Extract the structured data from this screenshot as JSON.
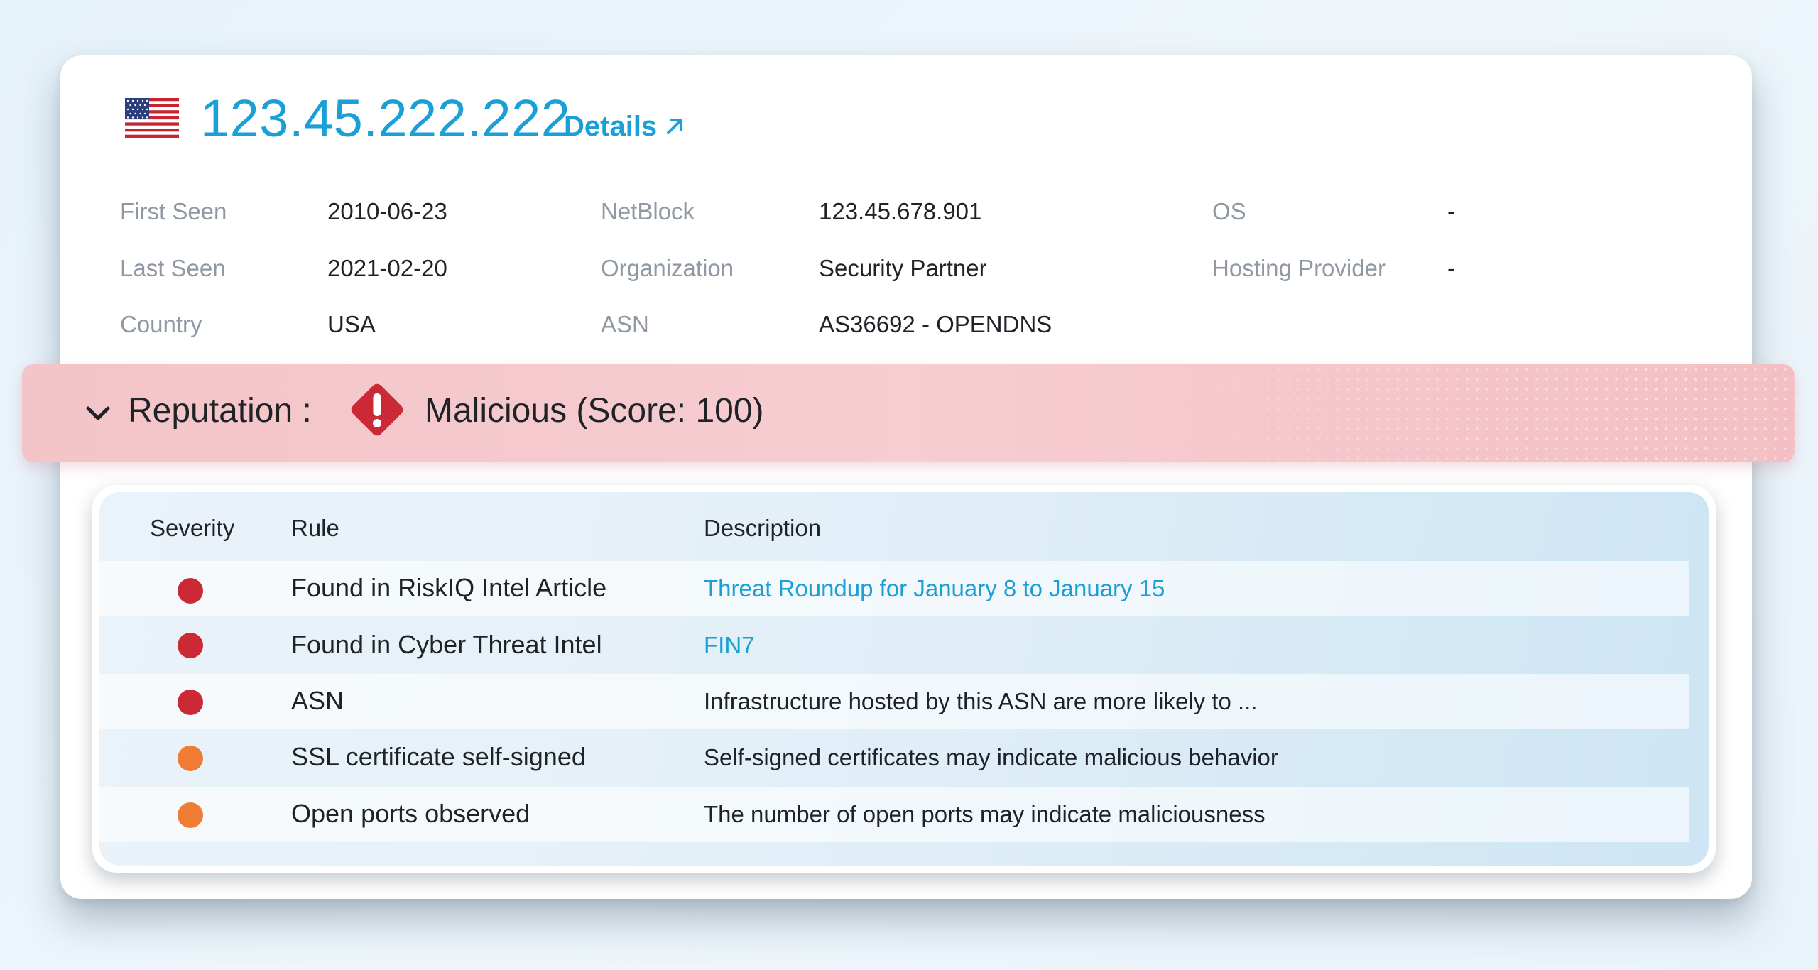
{
  "header": {
    "flag_icon": "us-flag-icon",
    "ip": "123.45.222.222",
    "details_label": "Details",
    "details_icon": "external-link-arrow-icon"
  },
  "info": {
    "first_seen_label": "First Seen",
    "first_seen_value": "2010-06-23",
    "last_seen_label": "Last Seen",
    "last_seen_value": "2021-02-20",
    "country_label": "Country",
    "country_value": "USA",
    "netblock_label": "NetBlock",
    "netblock_value": "123.45.678.901",
    "organization_label": "Organization",
    "organization_value": "Security Partner",
    "asn_label": "ASN",
    "asn_value": "AS36692 - OPENDNS",
    "os_label": "OS",
    "os_value": "-",
    "hosting_label": "Hosting Provider",
    "hosting_value": "-"
  },
  "reputation": {
    "label": "Reputation :",
    "value": "Malicious (Score: 100)",
    "icon": "alert-diamond-icon",
    "chevron": "chevron-down-icon"
  },
  "table": {
    "headers": {
      "severity": "Severity",
      "rule": "Rule",
      "description": "Description"
    },
    "rows": [
      {
        "severity": "high",
        "rule": "Found in RiskIQ Intel Article",
        "description": "Threat Roundup for January 8 to January 15",
        "is_link": true
      },
      {
        "severity": "high",
        "rule": "Found in Cyber Threat Intel",
        "description": "FIN7",
        "is_link": true
      },
      {
        "severity": "high",
        "rule": "ASN",
        "description": "Infrastructure hosted by this ASN are more likely to ...",
        "is_link": false
      },
      {
        "severity": "medium",
        "rule": "SSL certificate self-signed",
        "description": "Self-signed certificates may indicate malicious behavior",
        "is_link": false
      },
      {
        "severity": "medium",
        "rule": "Open ports observed",
        "description": "The number of open ports may indicate maliciousness",
        "is_link": false
      }
    ]
  },
  "colors": {
    "accent": "#1a9fd6",
    "severity_high": "#cc2936",
    "severity_medium": "#f07c34",
    "reputation_bg": "#f5c9cd"
  }
}
